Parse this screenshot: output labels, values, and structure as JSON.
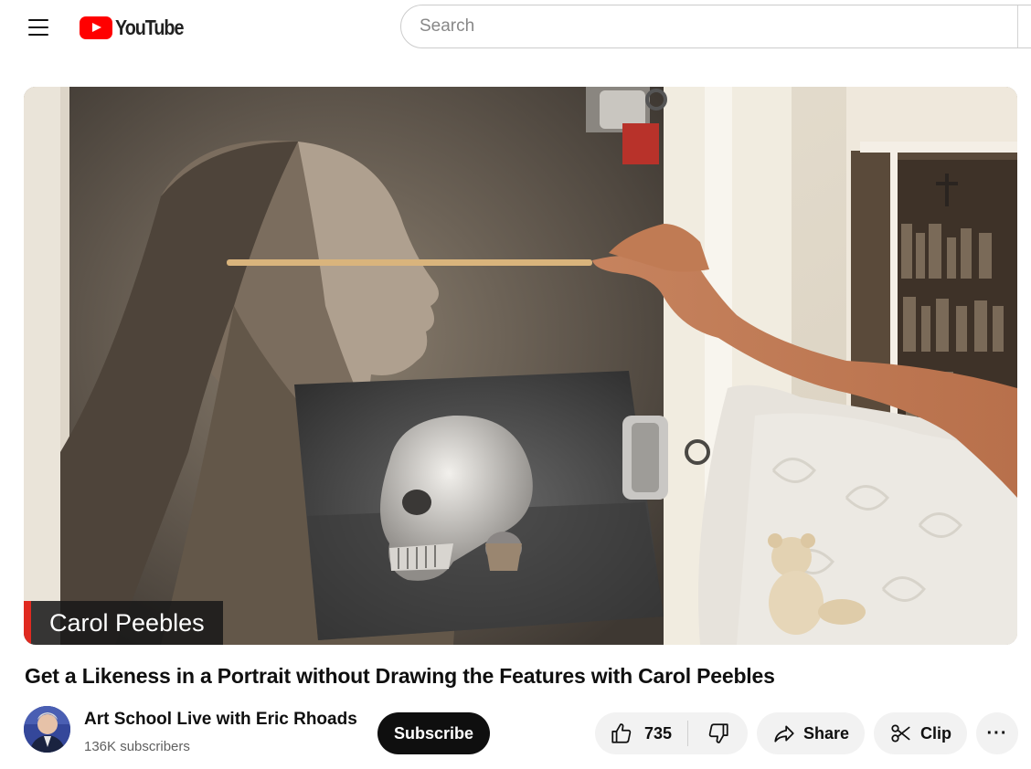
{
  "header": {
    "logo_text": "YouTube",
    "search_placeholder": "Search"
  },
  "player": {
    "lower_third_name": "Carol Peebles"
  },
  "video": {
    "title": "Get a Likeness in a Portrait without Drawing the Features with Carol Peebles"
  },
  "channel": {
    "name": "Art School Live with Eric Rhoads",
    "subscribers": "136K subscribers",
    "subscribe_label": "Subscribe"
  },
  "actions": {
    "like_count": "735",
    "share_label": "Share",
    "clip_label": "Clip",
    "more_label": "···"
  },
  "icons": {
    "menu": "hamburger-menu-icon",
    "logo": "youtube-play-icon",
    "like": "thumbs-up-icon",
    "dislike": "thumbs-down-icon",
    "share": "share-arrow-icon",
    "clip": "scissors-icon",
    "more": "more-horizontal-icon"
  },
  "colors": {
    "brand_red": "#ff0000",
    "subscribe_bg": "#0f0f0f",
    "pill_bg": "#f2f2f2",
    "lower_third_accent": "#e02a20"
  }
}
